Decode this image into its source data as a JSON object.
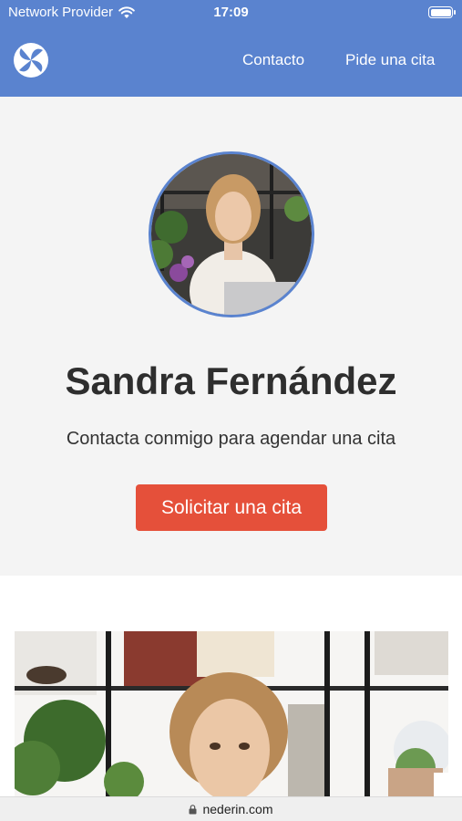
{
  "status_bar": {
    "carrier": "Network Provider",
    "time": "17:09",
    "battery_level": 1.0
  },
  "nav": {
    "logo_icon": "pinwheel-logo-icon",
    "links": [
      {
        "label": "Contacto"
      },
      {
        "label": "Pide una cita"
      }
    ]
  },
  "hero": {
    "name": "Sandra Fernández",
    "subtitle": "Contacta conmigo para agendar una cita",
    "cta_label": "Solicitar una cita"
  },
  "url_bar": {
    "url": "nederin.com",
    "icon": "lock-icon"
  },
  "colors": {
    "header_blue": "#5a83cf",
    "cta_red": "#e5503a",
    "hero_bg": "#f4f4f4",
    "text_dark": "#2e2e2e"
  }
}
